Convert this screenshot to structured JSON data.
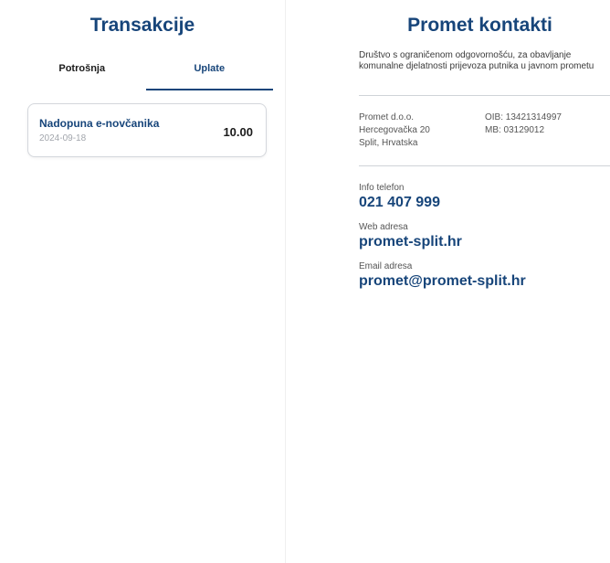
{
  "transactions_screen": {
    "title": "Transakcije",
    "tabs": [
      {
        "label": "Potrošnja",
        "active": false
      },
      {
        "label": "Uplate",
        "active": true
      }
    ],
    "items": [
      {
        "title": "Nadopuna e-novčanika",
        "date": "2024-09-18",
        "amount": "10.00"
      }
    ]
  },
  "contacts_screen": {
    "title": "Promet kontakti",
    "description": "Društvo s ograničenom odgovornošću, za obavljanje komunalne djelatnosti prijevoza putnika u javnom prometu",
    "company": {
      "name": "Promet d.o.o.",
      "street": "Hercegovačka 20",
      "city": "Split, Hrvatska",
      "oib": "OIB: 13421314997",
      "mb": "MB: 03129012"
    },
    "phone": {
      "label": "Info telefon",
      "value": "021 407 999"
    },
    "web": {
      "label": "Web adresa",
      "value": "promet-split.hr"
    },
    "email": {
      "label": "Email adresa",
      "value": "promet@promet-split.hr"
    }
  },
  "colors": {
    "brand": "#17457a",
    "text": "#1b1b1b",
    "muted": "#a2a6ac",
    "border": "#d4d7dc"
  }
}
